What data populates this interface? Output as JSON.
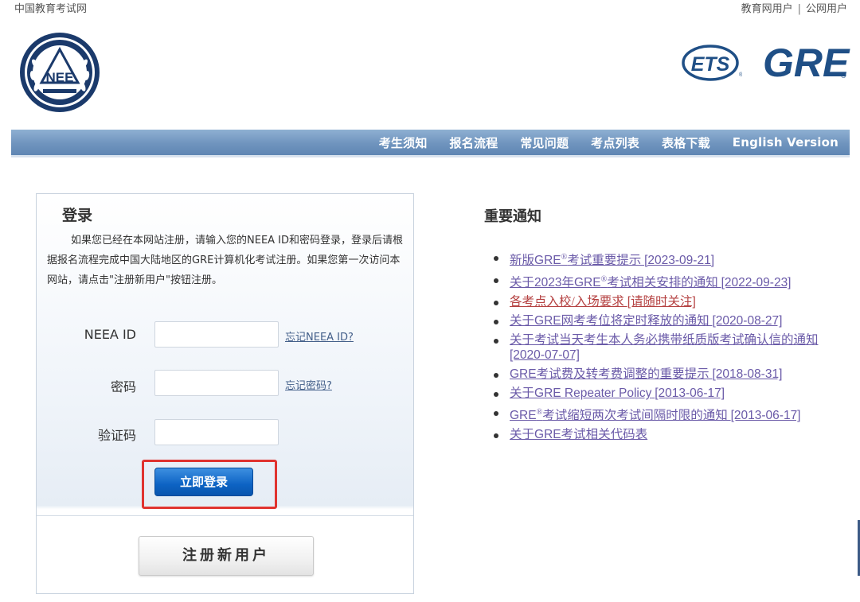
{
  "header": {
    "site_name": "中国教育考试网",
    "user_links": [
      "教育网用户",
      "公网用户"
    ],
    "separator": "|"
  },
  "logos": {
    "neea_text": "NEE",
    "ets_text": "ETS",
    "gre_text": "GRE"
  },
  "nav": {
    "items": [
      "考生须知",
      "报名流程",
      "常见问题",
      "考点列表",
      "表格下载",
      "English Version"
    ]
  },
  "login": {
    "title": "登录",
    "description": "如果您已经在本网站注册，请输入您的NEEA ID和密码登录，登录后请根据报名流程完成中国大陆地区的GRE计算机化考试注册。如果您第一次访问本网站，请点击\"注册新用户\"按钮注册。",
    "fields": [
      {
        "label": "NEEA ID",
        "value": "",
        "link": "忘记NEEA ID?"
      },
      {
        "label": "密码",
        "value": "",
        "link": "忘记密码?"
      },
      {
        "label": "验证码",
        "value": ""
      }
    ],
    "login_button": "立即登录",
    "register_button": "注册新用户"
  },
  "notices": {
    "title": "重要通知",
    "items": [
      {
        "pre": "新版",
        "latin": "GRE",
        "sup": "®",
        "post": "考试重要提示 ",
        "date": "[2023-09-21]",
        "color": "#6a5aa8"
      },
      {
        "pre": "关于",
        "latin": "2023年GRE",
        "sup": "®",
        "post": "考试相关安排的通知 ",
        "date": "[2022-09-23]",
        "color": "#6a5aa8"
      },
      {
        "pre": "各考点入校/入场要求 ",
        "latin": "",
        "sup": "",
        "post": "",
        "date": "[请随时关注]",
        "color": "#b54242"
      },
      {
        "pre": "关于",
        "latin": "GRE",
        "sup": "",
        "post": "网考考位将定时释放的通知 ",
        "date": "[2020-08-27]",
        "color": "#6a5aa8"
      },
      {
        "pre": "关于考试当天考生本人务必携带纸质版考试确认信的通知 ",
        "latin": "",
        "sup": "",
        "post": "",
        "date": "[2020-07-07]",
        "color": "#6a5aa8"
      },
      {
        "pre": "",
        "latin": "GRE",
        "sup": "",
        "post": "考试费及转考费调整的重要提示 ",
        "date": "[2018-08-31]",
        "color": "#6a5aa8"
      },
      {
        "pre": "关于",
        "latin": "GRE Repeater Policy",
        "sup": "",
        "post": " ",
        "date": "[2013-06-17]",
        "color": "#6a5aa8"
      },
      {
        "pre": "",
        "latin": "GRE",
        "sup": "®",
        "post": "考试缩短两次考试间隔时限的通知 ",
        "date": "[2013-06-17]",
        "color": "#6a5aa8"
      },
      {
        "pre": "关于",
        "latin": "GRE",
        "sup": "",
        "post": "考试相关代码表",
        "date": "",
        "color": "#6a5aa8"
      }
    ]
  },
  "colors": {
    "nav_bar": "#6f94be",
    "login_button": "#0d63c4",
    "highlight": "#e0332f",
    "link": "#6a5aa8",
    "link_alert": "#b54242"
  }
}
